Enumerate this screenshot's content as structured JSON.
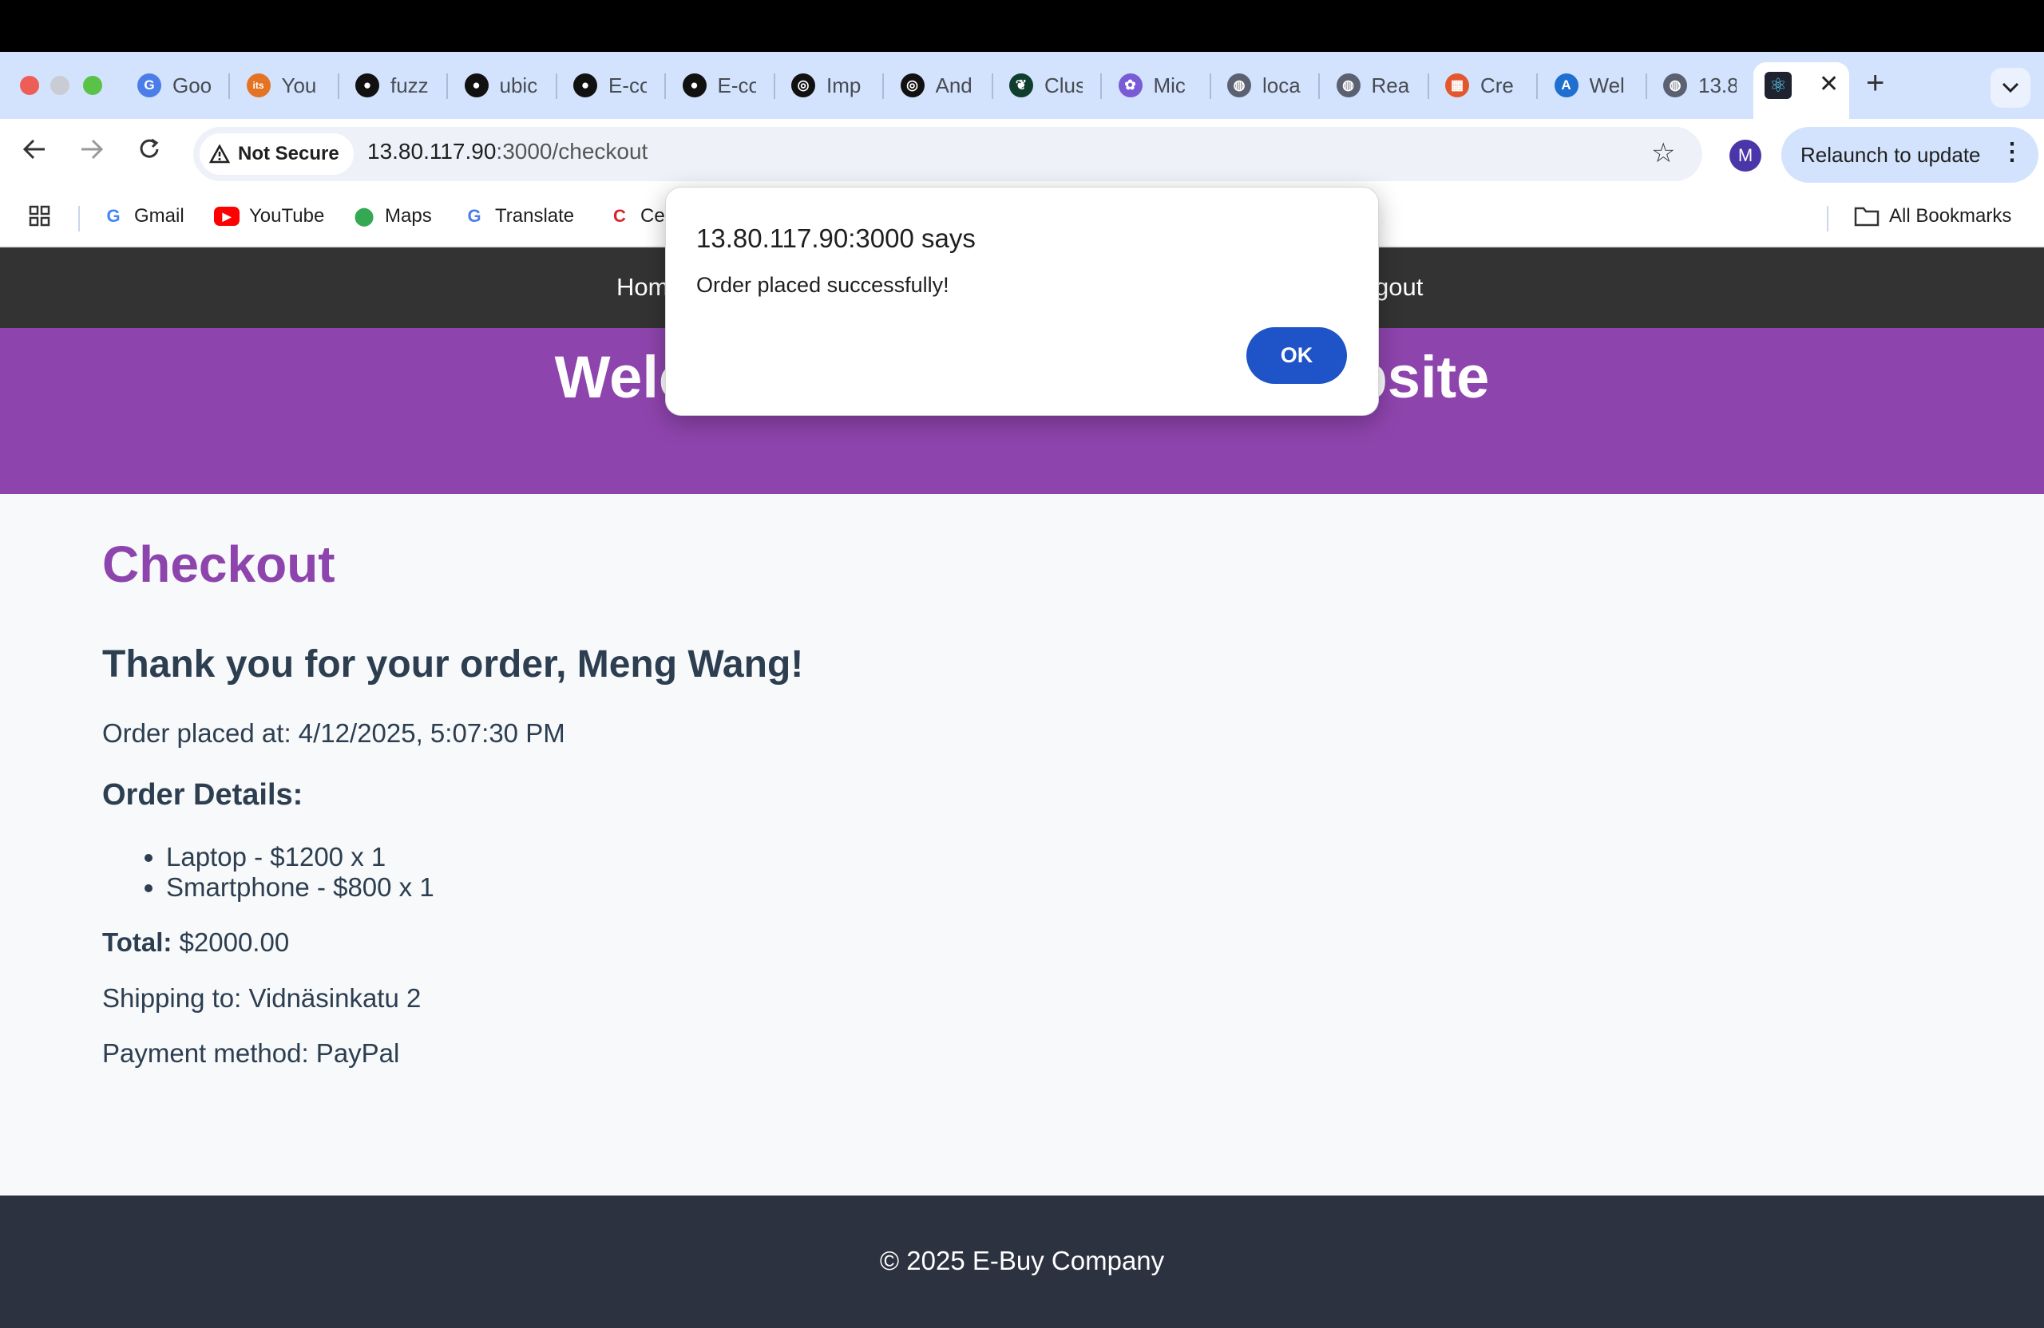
{
  "browser": {
    "tabs": [
      {
        "title": "Goo",
        "icon": "google-translate-icon"
      },
      {
        "title": "You",
        "icon": "its-icon"
      },
      {
        "title": "fuzz",
        "icon": "github-icon"
      },
      {
        "title": "ubic",
        "icon": "github-icon"
      },
      {
        "title": "E-co",
        "icon": "github-icon"
      },
      {
        "title": "E-co",
        "icon": "github-icon"
      },
      {
        "title": "Imp",
        "icon": "openai-icon"
      },
      {
        "title": "And",
        "icon": "openai-icon"
      },
      {
        "title": "Clus",
        "icon": "mongodb-icon"
      },
      {
        "title": "Mic",
        "icon": "copilot-icon"
      },
      {
        "title": "loca",
        "icon": "globe-icon"
      },
      {
        "title": "Rea",
        "icon": "globe-icon"
      },
      {
        "title": "Cre",
        "icon": "microsoft-icon"
      },
      {
        "title": "Wel",
        "icon": "azure-icon"
      },
      {
        "title": "13.8",
        "icon": "globe-icon"
      }
    ],
    "active_tab_icon": "react-icon",
    "security_label": "Not Secure",
    "url_host": "13.80.117.90",
    "url_path": ":3000/checkout",
    "avatar_letter": "M",
    "relaunch_label": "Relaunch to update",
    "bookmarks": [
      {
        "label": "Gmail",
        "icon": "google-icon"
      },
      {
        "label": "YouTube",
        "icon": "youtube-icon"
      },
      {
        "label": "Maps",
        "icon": "maps-icon"
      },
      {
        "label": "Translate",
        "icon": "translate-icon"
      },
      {
        "label": "Ce",
        "icon": "c-icon"
      }
    ],
    "all_bookmarks_label": "All Bookmarks"
  },
  "site": {
    "nav_home": "Hom",
    "nav_logout": "gout",
    "hero_title": "Welc                                    Vebsite",
    "checkout_heading": "Checkout",
    "thanks": "Thank you for your order, Meng Wang!",
    "placed_at": "Order placed at: 4/12/2025, 5:07:30 PM",
    "details_heading": "Order Details:",
    "items": [
      "Laptop - $1200 x 1",
      "Smartphone - $800 x 1"
    ],
    "total_label": "Total:",
    "total_value": " $2000.00",
    "shipping": "Shipping to: Vidnäsinkatu 2",
    "payment": "Payment method: PayPal",
    "footer": "© 2025 E-Buy Company"
  },
  "dialog": {
    "title": "13.80.117.90:3000 says",
    "message": "Order placed successfully!",
    "ok_label": "OK"
  },
  "colors": {
    "accent_purple": "#8e44ad",
    "nav_dark": "#333333",
    "footer_dark": "#2c3240",
    "ok_button": "#1f53c8"
  }
}
